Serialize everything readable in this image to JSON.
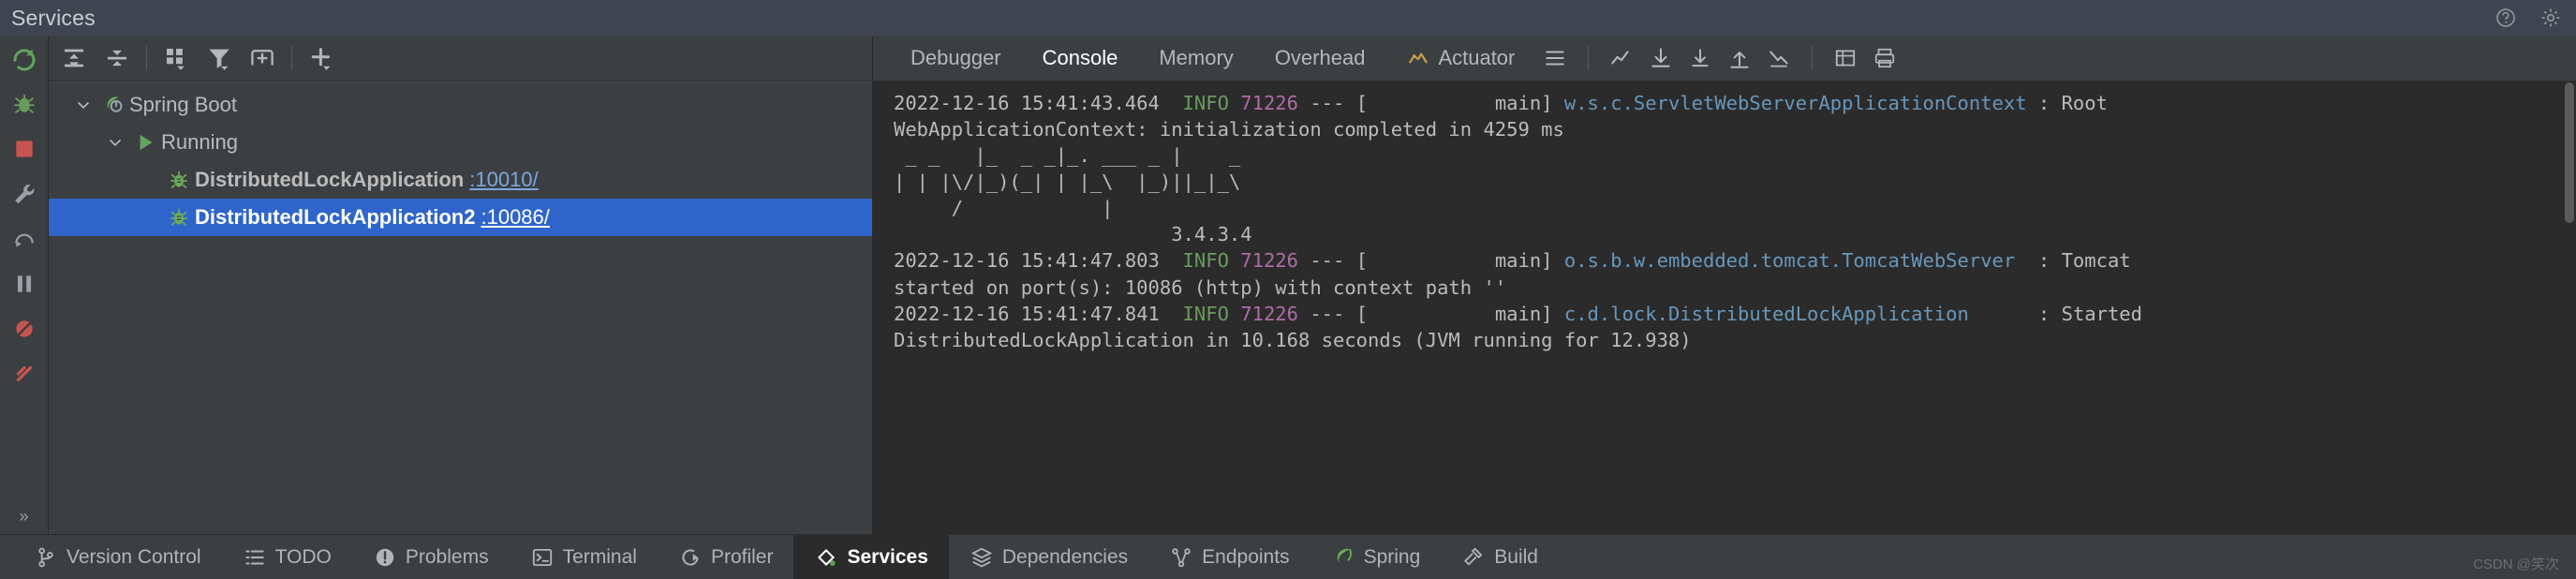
{
  "titlebar": {
    "title": "Services",
    "icons": [
      {
        "name": "help-icon",
        "glyph": "?"
      },
      {
        "name": "settings-gear-icon",
        "glyph": "gear"
      }
    ]
  },
  "rail": {
    "items": [
      {
        "name": "rerun-icon",
        "glyph": "rerun",
        "color": "#62a35f"
      },
      {
        "name": "debug-icon",
        "glyph": "bug",
        "color": "#6a9b5e"
      },
      {
        "name": "stop-icon",
        "glyph": "square",
        "color": "#c75450"
      },
      {
        "name": "settings-wrench-icon",
        "glyph": "wrench",
        "color": "#9aa0a6"
      },
      {
        "name": "step-over-icon",
        "glyph": "stepover",
        "color": "#9aa0a6"
      },
      {
        "name": "pause-icon",
        "glyph": "pause",
        "color": "#9aa0a6"
      },
      {
        "name": "mute-breakpoints-icon",
        "glyph": "circle-slash",
        "color": "#c75450"
      },
      {
        "name": "view-breakpoints-icon",
        "glyph": "slash",
        "color": "#c75450"
      }
    ],
    "more_label": "»"
  },
  "services_toolbar": {
    "buttons": [
      {
        "name": "expand-all-button",
        "label": "Expand All",
        "glyph": "expand"
      },
      {
        "name": "collapse-all-button",
        "label": "Collapse All",
        "glyph": "collapse"
      },
      {
        "name": "group-by-button",
        "label": "Group By",
        "glyph": "grid"
      },
      {
        "name": "filter-button",
        "label": "Filter",
        "glyph": "funnel"
      },
      {
        "name": "add-tab-button",
        "label": "Add Tab",
        "glyph": "tabplus"
      },
      {
        "name": "add-service-button",
        "label": "Add Service",
        "glyph": "plus"
      }
    ]
  },
  "tree": {
    "nodes": [
      {
        "name": "spring-boot-group",
        "label": "Spring Boot",
        "port": "",
        "level": 1,
        "expanded": true,
        "selected": false,
        "icon": "spring-boot-icon",
        "bold": false
      },
      {
        "name": "running-group",
        "label": "Running",
        "port": "",
        "level": 2,
        "expanded": true,
        "selected": false,
        "icon": "run-green-icon",
        "bold": false
      },
      {
        "name": "service-distributedlockapplication",
        "label": "DistributedLockApplication",
        "port": ":10010/",
        "level": 3,
        "expanded": null,
        "selected": false,
        "icon": "debug-bug-icon",
        "bold": true
      },
      {
        "name": "service-distributedlockapplication2",
        "label": "DistributedLockApplication2",
        "port": ":10086/",
        "level": 3,
        "expanded": null,
        "selected": true,
        "icon": "debug-bug-icon",
        "bold": true
      }
    ]
  },
  "console_tabs": {
    "tabs": [
      {
        "name": "tab-debugger",
        "label": "Debugger",
        "active": false,
        "icon": ""
      },
      {
        "name": "tab-console",
        "label": "Console",
        "active": true,
        "icon": ""
      },
      {
        "name": "tab-memory",
        "label": "Memory",
        "active": false,
        "icon": ""
      },
      {
        "name": "tab-overhead",
        "label": "Overhead",
        "active": false,
        "icon": ""
      },
      {
        "name": "tab-actuator",
        "label": "Actuator",
        "active": false,
        "icon": "actuator-icon"
      }
    ],
    "toolbar_buttons": [
      {
        "name": "menu-lines-icon",
        "glyph": "lines"
      },
      {
        "name": "chart-up-icon",
        "glyph": "chartup"
      },
      {
        "name": "download-icon",
        "glyph": "download"
      },
      {
        "name": "download-alt-icon",
        "glyph": "download2"
      },
      {
        "name": "upload-icon",
        "glyph": "upload"
      },
      {
        "name": "trend-down-icon",
        "glyph": "trenddown"
      },
      {
        "name": "table-icon",
        "glyph": "table"
      },
      {
        "name": "print-icon",
        "glyph": "print"
      }
    ]
  },
  "console": {
    "lines": [
      {
        "name": "log-line-1",
        "segments": [
          {
            "text": "2022-12-16 15:41:43.464 ",
            "cls": ""
          },
          {
            "text": " INFO ",
            "cls": "c-info"
          },
          {
            "text": "71226",
            "cls": "c-pid"
          },
          {
            "text": " --- [           main] ",
            "cls": ""
          },
          {
            "text": "w.s.c.ServletWebServerApplicationContext",
            "cls": "c-cls"
          },
          {
            "text": " : Root",
            "cls": ""
          }
        ]
      },
      {
        "name": "log-line-2",
        "segments": [
          {
            "text": "WebApplicationContext: initialization completed in 4259 ms",
            "cls": ""
          }
        ]
      },
      {
        "name": "banner-line-1",
        "segments": [
          {
            "text": " _ _   |_  _ _|_. ___ _ |    _ ",
            "cls": ""
          }
        ]
      },
      {
        "name": "banner-line-2",
        "segments": [
          {
            "text": "| | |\\/|_)(_| | |_\\  |_)||_|_\\",
            "cls": ""
          }
        ]
      },
      {
        "name": "banner-line-3",
        "segments": [
          {
            "text": "     /            |             ",
            "cls": ""
          }
        ]
      },
      {
        "name": "banner-version",
        "segments": [
          {
            "text": "                        3.4.3.4",
            "cls": ""
          }
        ]
      },
      {
        "name": "log-line-3",
        "segments": [
          {
            "text": "2022-12-16 15:41:47.803 ",
            "cls": ""
          },
          {
            "text": " INFO ",
            "cls": "c-info"
          },
          {
            "text": "71226",
            "cls": "c-pid"
          },
          {
            "text": " --- [           main] ",
            "cls": ""
          },
          {
            "text": "o.s.b.w.embedded.tomcat.TomcatWebServer",
            "cls": "c-cls"
          },
          {
            "text": "  : Tomcat",
            "cls": ""
          }
        ]
      },
      {
        "name": "log-line-4",
        "segments": [
          {
            "text": "started on port(s): 10086 (http) with context path ''",
            "cls": ""
          }
        ]
      },
      {
        "name": "log-line-5",
        "segments": [
          {
            "text": "2022-12-16 15:41:47.841 ",
            "cls": ""
          },
          {
            "text": " INFO ",
            "cls": "c-info"
          },
          {
            "text": "71226",
            "cls": "c-pid"
          },
          {
            "text": " --- [           main] ",
            "cls": ""
          },
          {
            "text": "c.d.lock.DistributedLockApplication",
            "cls": "c-cls"
          },
          {
            "text": "      : Started",
            "cls": ""
          }
        ]
      },
      {
        "name": "log-line-6",
        "segments": [
          {
            "text": "DistributedLockApplication in 10.168 seconds (JVM running for 12.938)",
            "cls": ""
          }
        ]
      }
    ]
  },
  "bottombar": {
    "items": [
      {
        "name": "bottom-tab-version-control",
        "label": "Version Control",
        "icon": "branch-icon",
        "active": false
      },
      {
        "name": "bottom-tab-todo",
        "label": "TODO",
        "icon": "list-icon",
        "active": false
      },
      {
        "name": "bottom-tab-problems",
        "label": "Problems",
        "icon": "exclamation-circle-icon",
        "active": false
      },
      {
        "name": "bottom-tab-terminal",
        "label": "Terminal",
        "icon": "terminal-icon",
        "active": false
      },
      {
        "name": "bottom-tab-profiler",
        "label": "Profiler",
        "icon": "profiler-icon",
        "active": false
      },
      {
        "name": "bottom-tab-services",
        "label": "Services",
        "icon": "services-icon",
        "active": true
      },
      {
        "name": "bottom-tab-dependencies",
        "label": "Dependencies",
        "icon": "layers-icon",
        "active": false
      },
      {
        "name": "bottom-tab-endpoints",
        "label": "Endpoints",
        "icon": "endpoints-icon",
        "active": false
      },
      {
        "name": "bottom-tab-spring",
        "label": "Spring",
        "icon": "spring-leaf-icon",
        "active": false
      },
      {
        "name": "bottom-tab-build",
        "label": "Build",
        "icon": "hammer-icon",
        "active": false
      }
    ]
  },
  "watermark": {
    "text": "CSDN @笑次"
  },
  "colors": {
    "accent_selection": "#2f65ca",
    "green": "#6a9b5e",
    "red": "#c75450",
    "link_blue": "#7aa7e0",
    "console_bg": "#2b2b2b",
    "panel_bg": "#3c3f41",
    "title_bg": "#3f4550"
  }
}
